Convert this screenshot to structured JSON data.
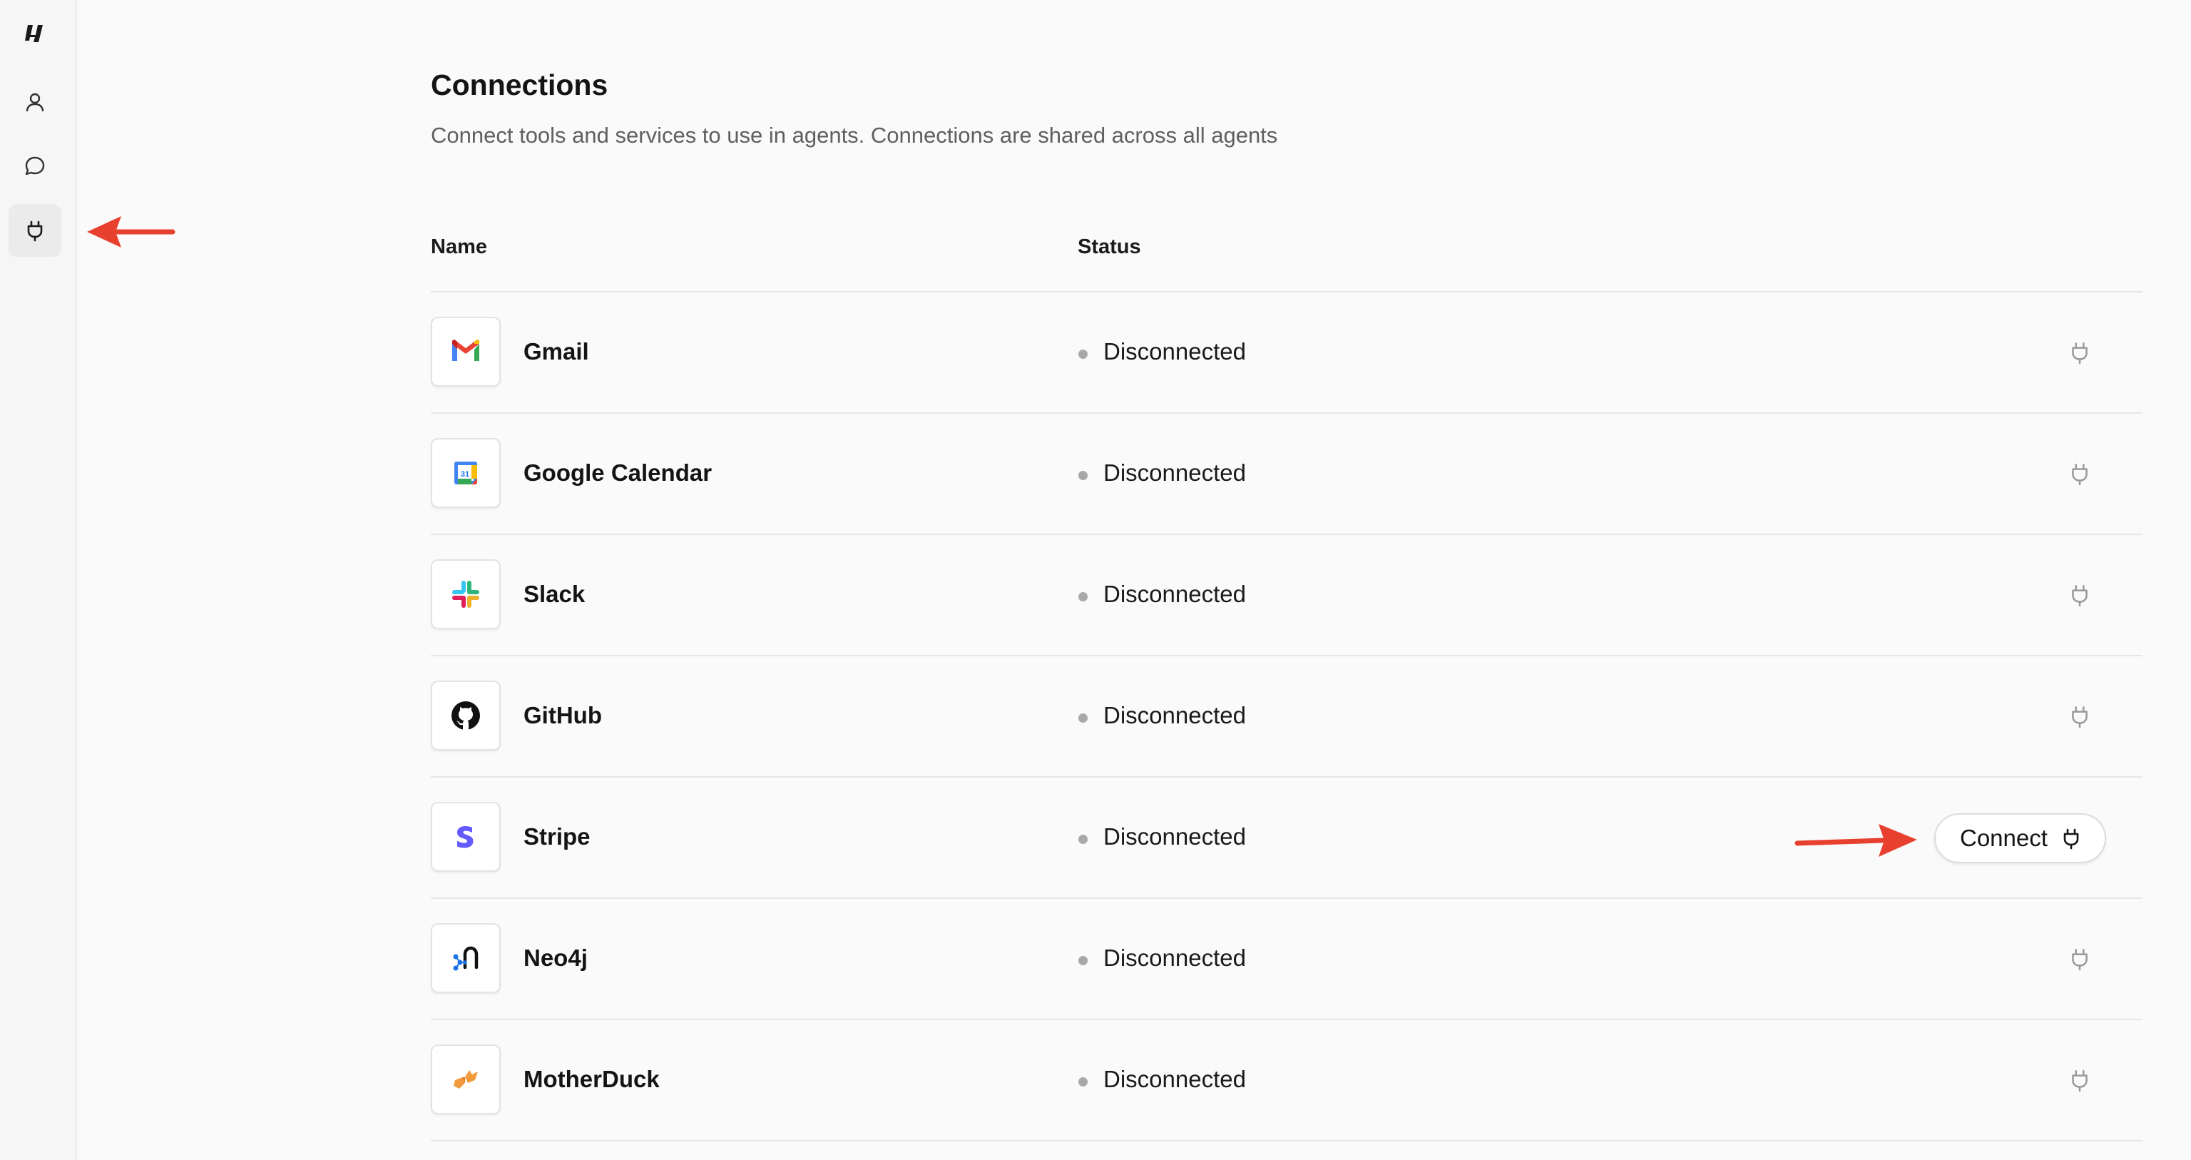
{
  "sidebar": {
    "items": [
      {
        "icon": "logo-icon"
      },
      {
        "icon": "user-icon"
      },
      {
        "icon": "chat-icon"
      },
      {
        "icon": "plug-icon",
        "active": true
      }
    ]
  },
  "page": {
    "title": "Connections",
    "subtitle": "Connect tools and services to use in agents. Connections are shared across all agents"
  },
  "table": {
    "headers": {
      "name": "Name",
      "status": "Status"
    },
    "rows": [
      {
        "name": "Gmail",
        "status": "Disconnected",
        "logo": "gmail-logo"
      },
      {
        "name": "Google Calendar",
        "status": "Disconnected",
        "logo": "google-calendar-logo",
        "logo_text": "31"
      },
      {
        "name": "Slack",
        "status": "Disconnected",
        "logo": "slack-logo"
      },
      {
        "name": "GitHub",
        "status": "Disconnected",
        "logo": "github-logo"
      },
      {
        "name": "Stripe",
        "status": "Disconnected",
        "logo": "stripe-logo",
        "action_label": "Connect"
      },
      {
        "name": "Neo4j",
        "status": "Disconnected",
        "logo": "neo4j-logo"
      },
      {
        "name": "MotherDuck",
        "status": "Disconnected",
        "logo": "motherduck-logo"
      }
    ]
  },
  "colors": {
    "annotation_arrow": "#e8402f",
    "status_dot": "#a8a8a8",
    "stripe": "#635bff"
  }
}
